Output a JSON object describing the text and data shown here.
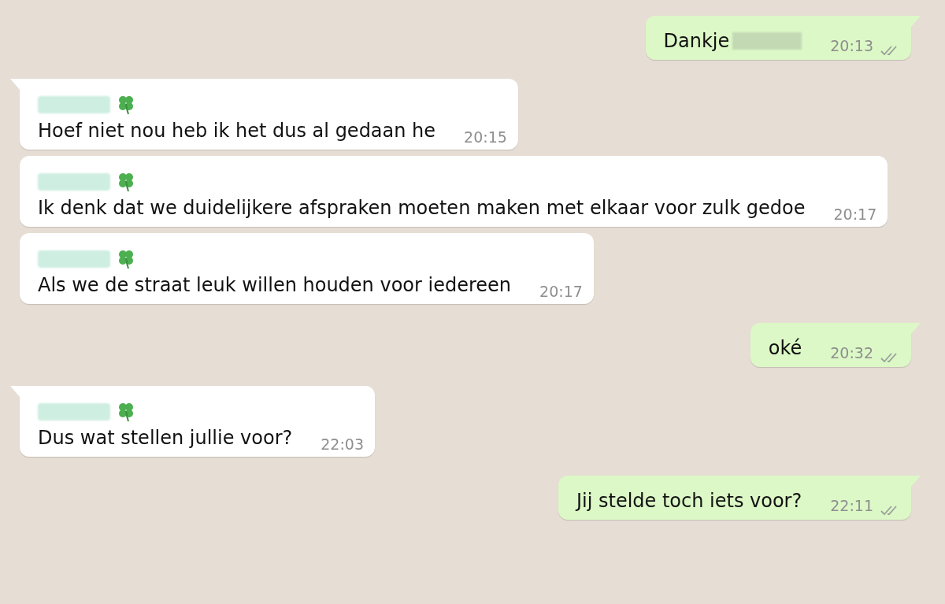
{
  "messages": [
    {
      "kind": "outgoing",
      "tail": true,
      "text": "Dankje",
      "redacted_after_text": true,
      "time": "20:13"
    },
    {
      "kind": "incoming",
      "tail": true,
      "text": "Hoef niet nou heb ik het dus al gedaan he",
      "time": "20:15"
    },
    {
      "kind": "incoming",
      "tail": false,
      "text": "Ik denk dat we duidelijkere afspraken moeten maken met elkaar voor zulk gedoe",
      "time": "20:17"
    },
    {
      "kind": "incoming",
      "tail": false,
      "text": "Als we de straat leuk willen houden voor iedereen",
      "time": "20:17"
    },
    {
      "kind": "outgoing",
      "tail": true,
      "text": "oké",
      "redacted_after_text": false,
      "time": "20:32"
    },
    {
      "kind": "incoming",
      "tail": true,
      "text": "Dus wat stellen jullie voor?",
      "time": "22:03"
    },
    {
      "kind": "outgoing",
      "tail": true,
      "text": "Jij stelde toch iets voor?",
      "redacted_after_text": false,
      "time": "22:11"
    }
  ]
}
